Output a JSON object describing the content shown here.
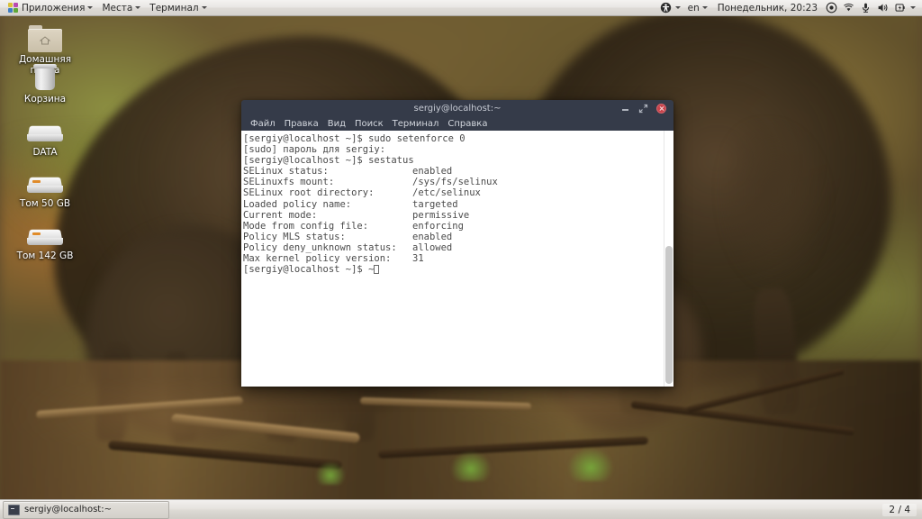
{
  "top_panel": {
    "apps_menu": {
      "label": "Приложения",
      "icon": "fedora-pinwheel-icon"
    },
    "places_menu": {
      "label": "Места"
    },
    "terminal_menu": {
      "label": "Терминал"
    },
    "accessibility_icon": "accessibility-icon",
    "keyboard_layout": "en",
    "clock": "Понедельник, 20:23",
    "tray_icons": [
      "location-icon",
      "network-wifi-icon",
      "microphone-icon",
      "volume-icon",
      "battery-icon"
    ],
    "tray_caret": "chevron-down-icon"
  },
  "desktop_icons": [
    {
      "name": "home-folder",
      "icon": "folder-home-icon",
      "label": "Домашняя папка"
    },
    {
      "name": "trash",
      "icon": "trash-icon",
      "label": "Корзина"
    },
    {
      "name": "data-volume",
      "icon": "drive-icon",
      "label": "DATA"
    },
    {
      "name": "volume-50gb",
      "icon": "drive-icon",
      "label": "Том 50 GB"
    },
    {
      "name": "volume-142gb",
      "icon": "drive-icon",
      "label": "Том 142 GB"
    }
  ],
  "terminal": {
    "title": "sergiy@localhost:~",
    "menu": [
      "Файл",
      "Правка",
      "Вид",
      "Поиск",
      "Терминал",
      "Справка"
    ],
    "window_controls": {
      "minimize": "minimize-icon",
      "maximize": "maximize-icon",
      "close": "close-icon"
    },
    "lines": [
      {
        "type": "prompt",
        "text": "[sergiy@localhost ~]$ sudo setenforce 0"
      },
      {
        "type": "plain",
        "text": "[sudo] пароль для sergiy:"
      },
      {
        "type": "prompt",
        "text": "[sergiy@localhost ~]$ sestatus"
      },
      {
        "type": "kv",
        "key": "SELinux status:",
        "value": "enabled"
      },
      {
        "type": "kv",
        "key": "SELinuxfs mount:",
        "value": "/sys/fs/selinux"
      },
      {
        "type": "kv",
        "key": "SELinux root directory:",
        "value": "/etc/selinux"
      },
      {
        "type": "kv",
        "key": "Loaded policy name:",
        "value": "targeted"
      },
      {
        "type": "kv",
        "key": "Current mode:",
        "value": "permissive"
      },
      {
        "type": "kv",
        "key": "Mode from config file:",
        "value": "enforcing"
      },
      {
        "type": "kv",
        "key": "Policy MLS status:",
        "value": "enabled"
      },
      {
        "type": "kv",
        "key": "Policy deny_unknown status:",
        "value": "allowed"
      },
      {
        "type": "kv",
        "key": "Max kernel policy version:",
        "value": "31"
      },
      {
        "type": "cursor",
        "text": "[sergiy@localhost ~]$ ~"
      }
    ]
  },
  "taskbar": {
    "task_button": {
      "label": "sergiy@localhost:~",
      "icon": "terminal-icon"
    },
    "workspace": "2 / 4"
  },
  "colors": {
    "panel_bg": "#e8e6e3",
    "titlebar_bg": "#353b49",
    "terminal_bg": "#ffffff",
    "terminal_fg": "#4b4b4b",
    "close_button": "#c9434b",
    "taskbar_bg": "#e6e3df"
  }
}
